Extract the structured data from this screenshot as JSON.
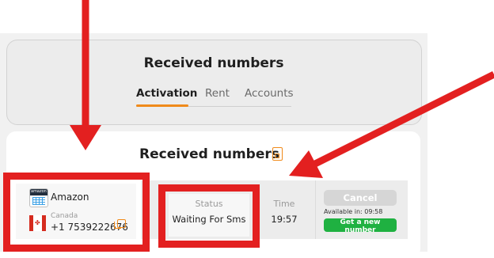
{
  "header": {
    "title": "Received numbers",
    "tabs": [
      {
        "label": "Activation",
        "active": true
      },
      {
        "label": "Rent",
        "active": false
      },
      {
        "label": "Accounts",
        "active": false
      }
    ]
  },
  "section": {
    "title": "Received numbers",
    "icon": "sim-card-icon"
  },
  "order": {
    "service": {
      "name": "Amazon",
      "logo": "amazon-logo"
    },
    "country": "Canada",
    "phone": "+1 7539222676",
    "status_header": "Status",
    "status_value": "Waiting For Sms",
    "time_header": "Time",
    "time_value": "19:57",
    "cancel_label": "Cancel",
    "available_text": "Available in: 09:58",
    "get_new_label": "Get a new number"
  },
  "colors": {
    "accent": "#f08a1a",
    "annotation_red": "#e32020",
    "get_button_green": "#1fb141",
    "cancel_disabled": "#d6d6d6"
  }
}
